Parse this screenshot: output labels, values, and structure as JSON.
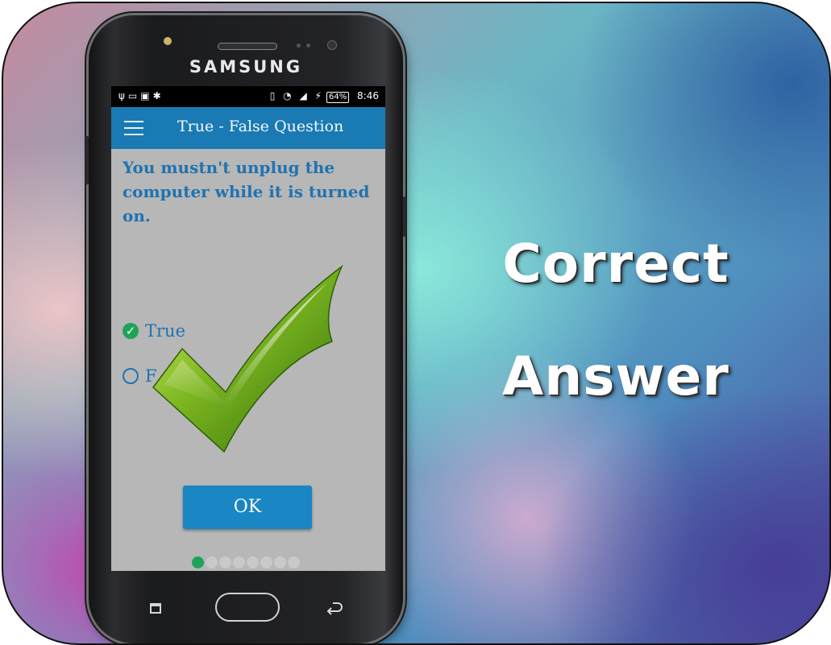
{
  "promo": {
    "headline_line1": "Correct",
    "headline_line2": "Answer"
  },
  "device": {
    "brand": "SAMSUNG"
  },
  "status_bar": {
    "battery_percent": "64%",
    "time": "8:46"
  },
  "app": {
    "title": "True - False Question",
    "menu_icon": "hamburger-menu-icon"
  },
  "question": {
    "text": "You mustn't unplug the computer while it is turned on.",
    "options": [
      {
        "label": "True",
        "selected": true
      },
      {
        "label": "F",
        "selected": false
      }
    ],
    "result_icon": "green-checkmark-icon"
  },
  "buttons": {
    "ok_label": "OK"
  },
  "pagination": {
    "total": 8,
    "current": 1
  },
  "colors": {
    "app_bar": "#1a7ab4",
    "accent_text": "#1f73b0",
    "correct_green": "#1fa35a",
    "screen_bg": "#b7b7b7"
  }
}
